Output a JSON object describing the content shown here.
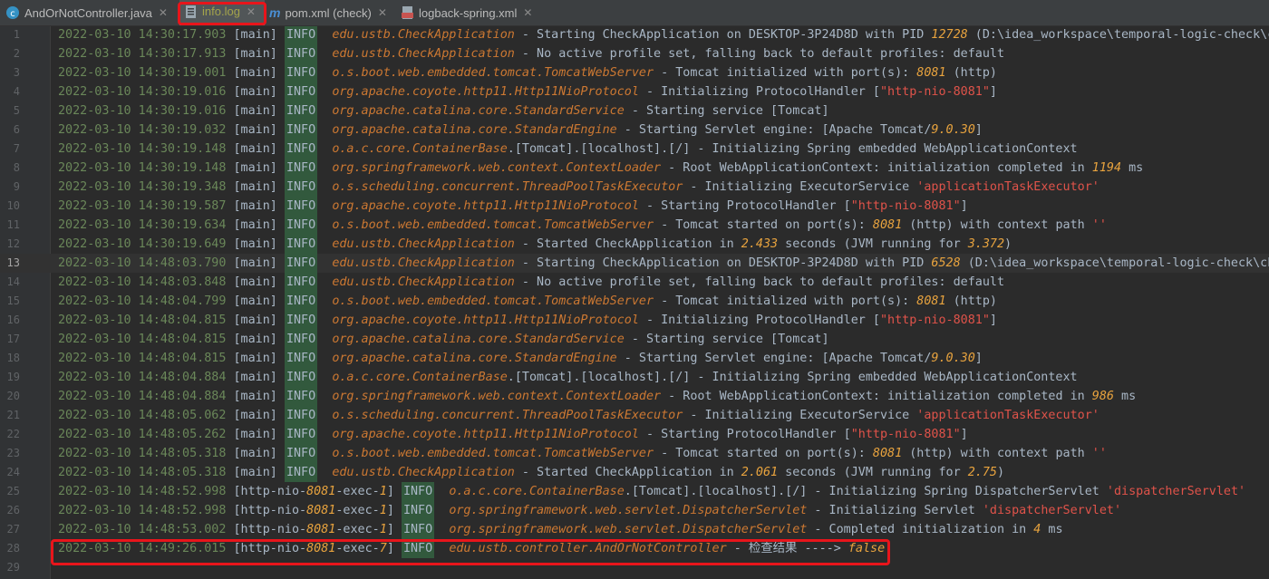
{
  "tabs": [
    {
      "label": "AndOrNotController.java",
      "icon": "java-class-icon",
      "active": false
    },
    {
      "label": "info.log",
      "icon": "log-file-icon",
      "active": true
    },
    {
      "label": "pom.xml (check)",
      "icon": "maven-icon",
      "active": false
    },
    {
      "label": "logback-spring.xml",
      "icon": "xml-file-icon",
      "active": false
    }
  ],
  "log_lines": [
    {
      "n": "1",
      "ts": "2022-03-10 14:30:17.903",
      "thread": "[main]",
      "level": "INFO",
      "logger": "edu.ustb.CheckApplication",
      "msg": [
        {
          "t": " - Starting CheckApplication on DESKTOP-3P24D8D with PID "
        },
        {
          "t": "12728",
          "c": "num"
        },
        {
          "t": " (D:\\idea_workspace\\temporal-logic-check\\ch"
        }
      ]
    },
    {
      "n": "2",
      "ts": "2022-03-10 14:30:17.913",
      "thread": "[main]",
      "level": "INFO",
      "logger": "edu.ustb.CheckApplication",
      "msg": [
        {
          "t": " - No active profile set, falling back to default profiles: default"
        }
      ]
    },
    {
      "n": "3",
      "ts": "2022-03-10 14:30:19.001",
      "thread": "[main]",
      "level": "INFO",
      "logger": "o.s.boot.web.embedded.tomcat.TomcatWebServer",
      "msg": [
        {
          "t": " - Tomcat initialized with port(s): "
        },
        {
          "t": "8081",
          "c": "num"
        },
        {
          "t": " (http)"
        }
      ]
    },
    {
      "n": "4",
      "ts": "2022-03-10 14:30:19.016",
      "thread": "[main]",
      "level": "INFO",
      "logger": "org.apache.coyote.http11.Http11NioProtocol",
      "msg": [
        {
          "t": " - Initializing ProtocolHandler ["
        },
        {
          "t": "\"http-nio-8081\"",
          "c": "str"
        },
        {
          "t": "]"
        }
      ]
    },
    {
      "n": "5",
      "ts": "2022-03-10 14:30:19.016",
      "thread": "[main]",
      "level": "INFO",
      "logger": "org.apache.catalina.core.StandardService",
      "msg": [
        {
          "t": " - Starting service [Tomcat]"
        }
      ]
    },
    {
      "n": "6",
      "ts": "2022-03-10 14:30:19.032",
      "thread": "[main]",
      "level": "INFO",
      "logger": "org.apache.catalina.core.StandardEngine",
      "msg": [
        {
          "t": " - Starting Servlet engine: [Apache Tomcat/"
        },
        {
          "t": "9.0.30",
          "c": "num"
        },
        {
          "t": "]"
        }
      ]
    },
    {
      "n": "7",
      "ts": "2022-03-10 14:30:19.148",
      "thread": "[main]",
      "level": "INFO",
      "logger": "o.a.c.core.ContainerBase",
      "msg": [
        {
          "t": ".[Tomcat].[localhost].[/] - Initializing Spring embedded WebApplicationContext"
        }
      ]
    },
    {
      "n": "8",
      "ts": "2022-03-10 14:30:19.148",
      "thread": "[main]",
      "level": "INFO",
      "logger": "org.springframework.web.context.ContextLoader",
      "msg": [
        {
          "t": " - Root WebApplicationContext: initialization completed in "
        },
        {
          "t": "1194",
          "c": "num"
        },
        {
          "t": " ms"
        }
      ]
    },
    {
      "n": "9",
      "ts": "2022-03-10 14:30:19.348",
      "thread": "[main]",
      "level": "INFO",
      "logger": "o.s.scheduling.concurrent.ThreadPoolTaskExecutor",
      "msg": [
        {
          "t": " - Initializing ExecutorService "
        },
        {
          "t": "'applicationTaskExecutor'",
          "c": "str"
        }
      ]
    },
    {
      "n": "10",
      "ts": "2022-03-10 14:30:19.587",
      "thread": "[main]",
      "level": "INFO",
      "logger": "org.apache.coyote.http11.Http11NioProtocol",
      "msg": [
        {
          "t": " - Starting ProtocolHandler ["
        },
        {
          "t": "\"http-nio-8081\"",
          "c": "str"
        },
        {
          "t": "]"
        }
      ]
    },
    {
      "n": "11",
      "ts": "2022-03-10 14:30:19.634",
      "thread": "[main]",
      "level": "INFO",
      "logger": "o.s.boot.web.embedded.tomcat.TomcatWebServer",
      "msg": [
        {
          "t": " - Tomcat started on port(s): "
        },
        {
          "t": "8081",
          "c": "num"
        },
        {
          "t": " (http) with context path "
        },
        {
          "t": "''",
          "c": "str"
        }
      ]
    },
    {
      "n": "12",
      "ts": "2022-03-10 14:30:19.649",
      "thread": "[main]",
      "level": "INFO",
      "logger": "edu.ustb.CheckApplication",
      "msg": [
        {
          "t": " - Started CheckApplication in "
        },
        {
          "t": "2.433",
          "c": "num"
        },
        {
          "t": " seconds (JVM running for "
        },
        {
          "t": "3.372",
          "c": "num"
        },
        {
          "t": ")"
        }
      ]
    },
    {
      "n": "13",
      "ts": "2022-03-10 14:48:03.790",
      "thread": "[main]",
      "level": "INFO",
      "logger": "edu.ustb.CheckApplication",
      "msg": [
        {
          "t": " - Starting CheckApplication on DESKTOP-3P24D8D with PID "
        },
        {
          "t": "6528",
          "c": "num"
        },
        {
          "t": " (D:\\idea_workspace\\temporal-logic-check\\che"
        }
      ]
    },
    {
      "n": "14",
      "ts": "2022-03-10 14:48:03.848",
      "thread": "[main]",
      "level": "INFO",
      "logger": "edu.ustb.CheckApplication",
      "msg": [
        {
          "t": " - No active profile set, falling back to default profiles: default"
        }
      ]
    },
    {
      "n": "15",
      "ts": "2022-03-10 14:48:04.799",
      "thread": "[main]",
      "level": "INFO",
      "logger": "o.s.boot.web.embedded.tomcat.TomcatWebServer",
      "msg": [
        {
          "t": " - Tomcat initialized with port(s): "
        },
        {
          "t": "8081",
          "c": "num"
        },
        {
          "t": " (http)"
        }
      ]
    },
    {
      "n": "16",
      "ts": "2022-03-10 14:48:04.815",
      "thread": "[main]",
      "level": "INFO",
      "logger": "org.apache.coyote.http11.Http11NioProtocol",
      "msg": [
        {
          "t": " - Initializing ProtocolHandler ["
        },
        {
          "t": "\"http-nio-8081\"",
          "c": "str"
        },
        {
          "t": "]"
        }
      ]
    },
    {
      "n": "17",
      "ts": "2022-03-10 14:48:04.815",
      "thread": "[main]",
      "level": "INFO",
      "logger": "org.apache.catalina.core.StandardService",
      "msg": [
        {
          "t": " - Starting service [Tomcat]"
        }
      ]
    },
    {
      "n": "18",
      "ts": "2022-03-10 14:48:04.815",
      "thread": "[main]",
      "level": "INFO",
      "logger": "org.apache.catalina.core.StandardEngine",
      "msg": [
        {
          "t": " - Starting Servlet engine: [Apache Tomcat/"
        },
        {
          "t": "9.0.30",
          "c": "num"
        },
        {
          "t": "]"
        }
      ]
    },
    {
      "n": "19",
      "ts": "2022-03-10 14:48:04.884",
      "thread": "[main]",
      "level": "INFO",
      "logger": "o.a.c.core.ContainerBase",
      "msg": [
        {
          "t": ".[Tomcat].[localhost].[/] - Initializing Spring embedded WebApplicationContext"
        }
      ]
    },
    {
      "n": "20",
      "ts": "2022-03-10 14:48:04.884",
      "thread": "[main]",
      "level": "INFO",
      "logger": "org.springframework.web.context.ContextLoader",
      "msg": [
        {
          "t": " - Root WebApplicationContext: initialization completed in "
        },
        {
          "t": "986",
          "c": "num"
        },
        {
          "t": " ms"
        }
      ]
    },
    {
      "n": "21",
      "ts": "2022-03-10 14:48:05.062",
      "thread": "[main]",
      "level": "INFO",
      "logger": "o.s.scheduling.concurrent.ThreadPoolTaskExecutor",
      "msg": [
        {
          "t": " - Initializing ExecutorService "
        },
        {
          "t": "'applicationTaskExecutor'",
          "c": "str"
        }
      ]
    },
    {
      "n": "22",
      "ts": "2022-03-10 14:48:05.262",
      "thread": "[main]",
      "level": "INFO",
      "logger": "org.apache.coyote.http11.Http11NioProtocol",
      "msg": [
        {
          "t": " - Starting ProtocolHandler ["
        },
        {
          "t": "\"http-nio-8081\"",
          "c": "str"
        },
        {
          "t": "]"
        }
      ]
    },
    {
      "n": "23",
      "ts": "2022-03-10 14:48:05.318",
      "thread": "[main]",
      "level": "INFO",
      "logger": "o.s.boot.web.embedded.tomcat.TomcatWebServer",
      "msg": [
        {
          "t": " - Tomcat started on port(s): "
        },
        {
          "t": "8081",
          "c": "num"
        },
        {
          "t": " (http) with context path "
        },
        {
          "t": "''",
          "c": "str"
        }
      ]
    },
    {
      "n": "24",
      "ts": "2022-03-10 14:48:05.318",
      "thread": "[main]",
      "level": "INFO",
      "logger": "edu.ustb.CheckApplication",
      "msg": [
        {
          "t": " - Started CheckApplication in "
        },
        {
          "t": "2.061",
          "c": "num"
        },
        {
          "t": " seconds (JVM running for "
        },
        {
          "t": "2.75",
          "c": "num"
        },
        {
          "t": ")"
        }
      ]
    },
    {
      "n": "25",
      "ts": "2022-03-10 14:48:52.998",
      "thread": [
        {
          "t": "[http-nio-"
        },
        {
          "t": "8081",
          "c": "num"
        },
        {
          "t": "-exec-"
        },
        {
          "t": "1",
          "c": "num"
        },
        {
          "t": "]"
        }
      ],
      "level": "INFO",
      "logger": "o.a.c.core.ContainerBase",
      "msg": [
        {
          "t": ".[Tomcat].[localhost].[/] - Initializing Spring DispatcherServlet "
        },
        {
          "t": "'dispatcherServlet'",
          "c": "str"
        }
      ]
    },
    {
      "n": "26",
      "ts": "2022-03-10 14:48:52.998",
      "thread": [
        {
          "t": "[http-nio-"
        },
        {
          "t": "8081",
          "c": "num"
        },
        {
          "t": "-exec-"
        },
        {
          "t": "1",
          "c": "num"
        },
        {
          "t": "]"
        }
      ],
      "level": "INFO",
      "logger": "org.springframework.web.servlet.DispatcherServlet",
      "msg": [
        {
          "t": " - Initializing Servlet "
        },
        {
          "t": "'dispatcherServlet'",
          "c": "str"
        }
      ]
    },
    {
      "n": "27",
      "ts": "2022-03-10 14:48:53.002",
      "thread": [
        {
          "t": "[http-nio-"
        },
        {
          "t": "8081",
          "c": "num"
        },
        {
          "t": "-exec-"
        },
        {
          "t": "1",
          "c": "num"
        },
        {
          "t": "]"
        }
      ],
      "level": "INFO",
      "logger": "org.springframework.web.servlet.DispatcherServlet",
      "msg": [
        {
          "t": " - Completed initialization in "
        },
        {
          "t": "4",
          "c": "num"
        },
        {
          "t": " ms"
        }
      ]
    },
    {
      "n": "28",
      "ts": "2022-03-10 14:49:26.015",
      "thread": [
        {
          "t": "[http-nio-"
        },
        {
          "t": "8081",
          "c": "num"
        },
        {
          "t": "-exec-"
        },
        {
          "t": "7",
          "c": "num"
        },
        {
          "t": "]"
        }
      ],
      "level": "INFO",
      "logger": "edu.ustb.controller.AndOrNotController",
      "msg": [
        {
          "t": " - 检查结果 ----> "
        },
        {
          "t": "false",
          "c": "num"
        }
      ]
    },
    {
      "n": "29"
    }
  ],
  "current_line": "13",
  "colors": {
    "background": "#2b2b2b",
    "timestamp": "#6a8759",
    "logger": "#cc7832",
    "number": "#e8a33e",
    "string": "#e0534a",
    "level_bg": "#32593d",
    "highlight_box": "#e8151b"
  }
}
